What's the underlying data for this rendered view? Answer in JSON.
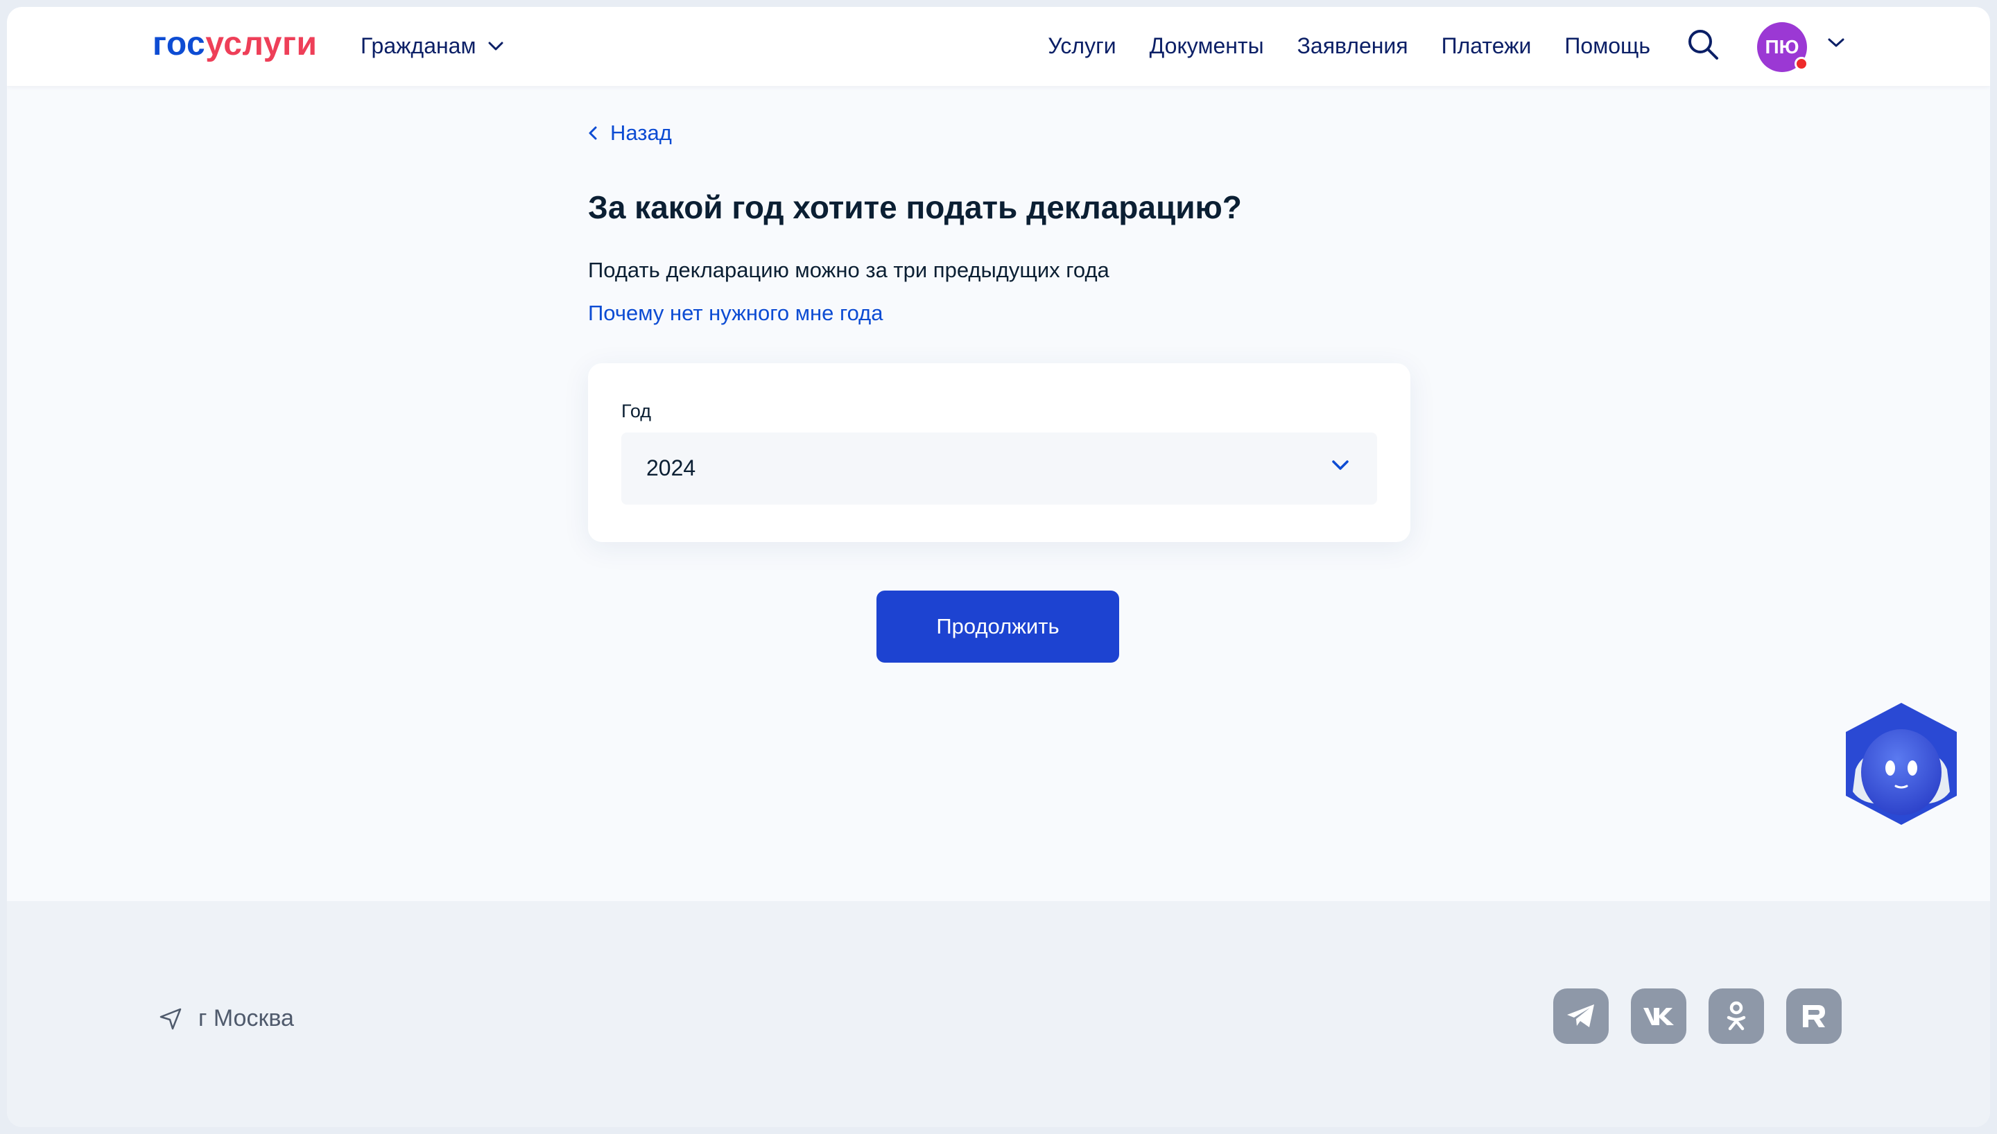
{
  "header": {
    "logo_part1": "гос",
    "logo_part2": "услуги",
    "citizens_label": "Гражданам",
    "nav": [
      "Услуги",
      "Документы",
      "Заявления",
      "Платежи",
      "Помощь"
    ],
    "avatar_initials": "ПЮ"
  },
  "main": {
    "back_label": "Назад",
    "title": "За какой год хотите подать декларацию?",
    "subtitle": "Подать декларацию можно за три предыдущих года",
    "why_link": "Почему нет нужного мне года",
    "year_field": {
      "label": "Год",
      "value": "2024"
    },
    "continue_label": "Продолжить"
  },
  "footer": {
    "location": "г Москва",
    "socials": [
      "telegram-icon",
      "vk-icon",
      "odnoklassniki-icon",
      "rutube-icon"
    ]
  },
  "colors": {
    "brand_blue": "#0d4cd3",
    "brand_red": "#ee3f58",
    "button_blue": "#1d43d1",
    "avatar_purple": "#9b38d4"
  }
}
